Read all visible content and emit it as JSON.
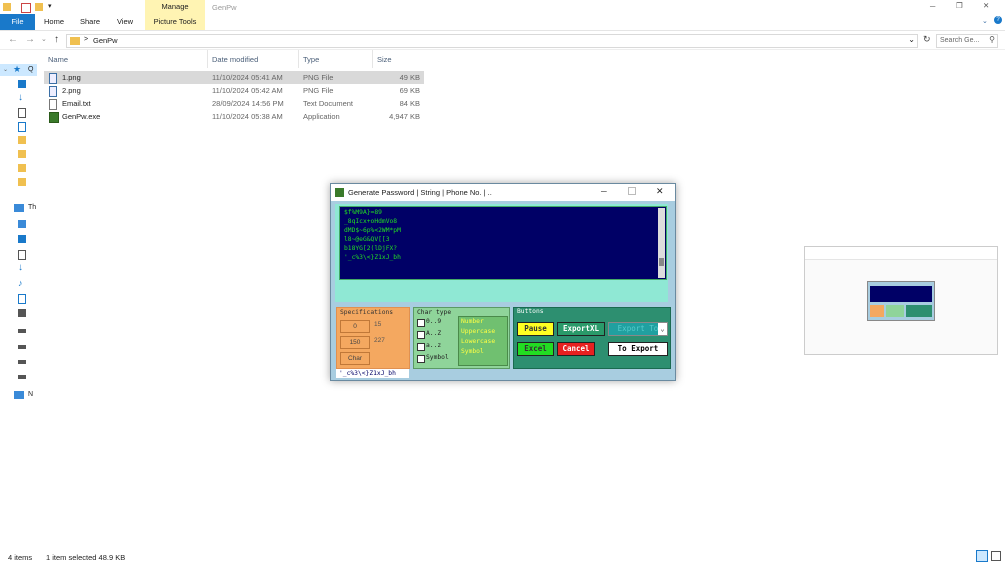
{
  "window": {
    "title": "GenPw",
    "manage_tab": "Manage",
    "min_glyph": "─",
    "max_glyph": "❐",
    "close_glyph": "✕"
  },
  "ribbon": {
    "tabs": [
      "File",
      "Home",
      "Share",
      "View",
      "Picture Tools"
    ],
    "help_glyph": "?"
  },
  "address": {
    "back": "←",
    "forward": "→",
    "up": "↑",
    "crumb_sep": ">",
    "path": "GenPw",
    "search_placeholder": "Search Ge..."
  },
  "navpane": {
    "first_label": "Q",
    "this_pc_label": "Th",
    "network_label": "N"
  },
  "columns": {
    "name": "Name",
    "date": "Date modified",
    "type": "Type",
    "size": "Size"
  },
  "files": [
    {
      "name": "1.png",
      "date": "11/10/2024 05:41 AM",
      "type": "PNG File",
      "size": "49 KB",
      "selected": true
    },
    {
      "name": "2.png",
      "date": "11/10/2024 05:42 AM",
      "type": "PNG File",
      "size": "69 KB",
      "selected": false
    },
    {
      "name": "Email.txt",
      "date": "28/09/2024 14:56 PM",
      "type": "Text Document",
      "size": "84 KB",
      "selected": false
    },
    {
      "name": "GenPw.exe",
      "date": "11/10/2024 05:38 AM",
      "type": "Application",
      "size": "4,947 KB",
      "selected": false
    }
  ],
  "status": {
    "count": "4 items",
    "selected": "1 item selected  48.9 KB"
  },
  "dialog": {
    "title": "Generate Password | String | Phone No. | ..",
    "output_lines": [
      "$f%M9A}=89",
      "_8qIcx+oHdmVo8",
      "dMD$~6p%<2WM*pM",
      "l8~@eG&QV[[3",
      "b18YG[2(lDjFX?",
      "'_c%3\\<}Z1xJ_bh"
    ],
    "spec": {
      "title": "Specifications",
      "a": "0",
      "a_val": "15",
      "b": "150",
      "b_val": "227",
      "char": "Char"
    },
    "chartype": {
      "title": "Char type",
      "checks": [
        "0..9",
        "A..Z",
        "a..z",
        "Symbol"
      ],
      "list": [
        "Number",
        "Uppercase",
        "Lowercase",
        "Symbol"
      ]
    },
    "buttons": {
      "title": "Buttons",
      "pause": "Pause",
      "exportxl": "ExportXL",
      "export_to": "Export To",
      "excel": "Excel",
      "cancel": "Cancel",
      "to_export": "To Export"
    },
    "last_password": "'_c%3\\<}Z1xJ_bh"
  },
  "colors": {
    "accent": "#1979ca",
    "console_bg": "#000066",
    "console_text": "#22dd22",
    "manage_bg": "#fff4b3"
  }
}
